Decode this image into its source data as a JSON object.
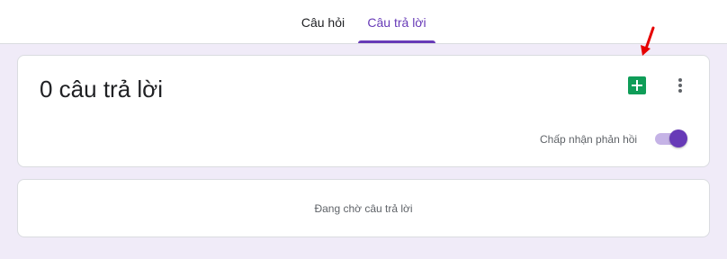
{
  "tabs": [
    {
      "label": "Câu hỏi",
      "active": false
    },
    {
      "label": "Câu trả lời",
      "active": true
    }
  ],
  "summary": {
    "count_label": "0 câu trả lời",
    "sheets_icon": "google-sheets-icon",
    "more_icon": "more-vert-icon",
    "accept_label": "Chấp nhận phản hồi",
    "accepting": true
  },
  "waiting": {
    "text": "Đang chờ câu trả lời"
  },
  "colors": {
    "accent": "#673ab7",
    "sheets_green": "#0f9d58",
    "background": "#f0ebf8",
    "annotation_arrow": "#e60000"
  }
}
